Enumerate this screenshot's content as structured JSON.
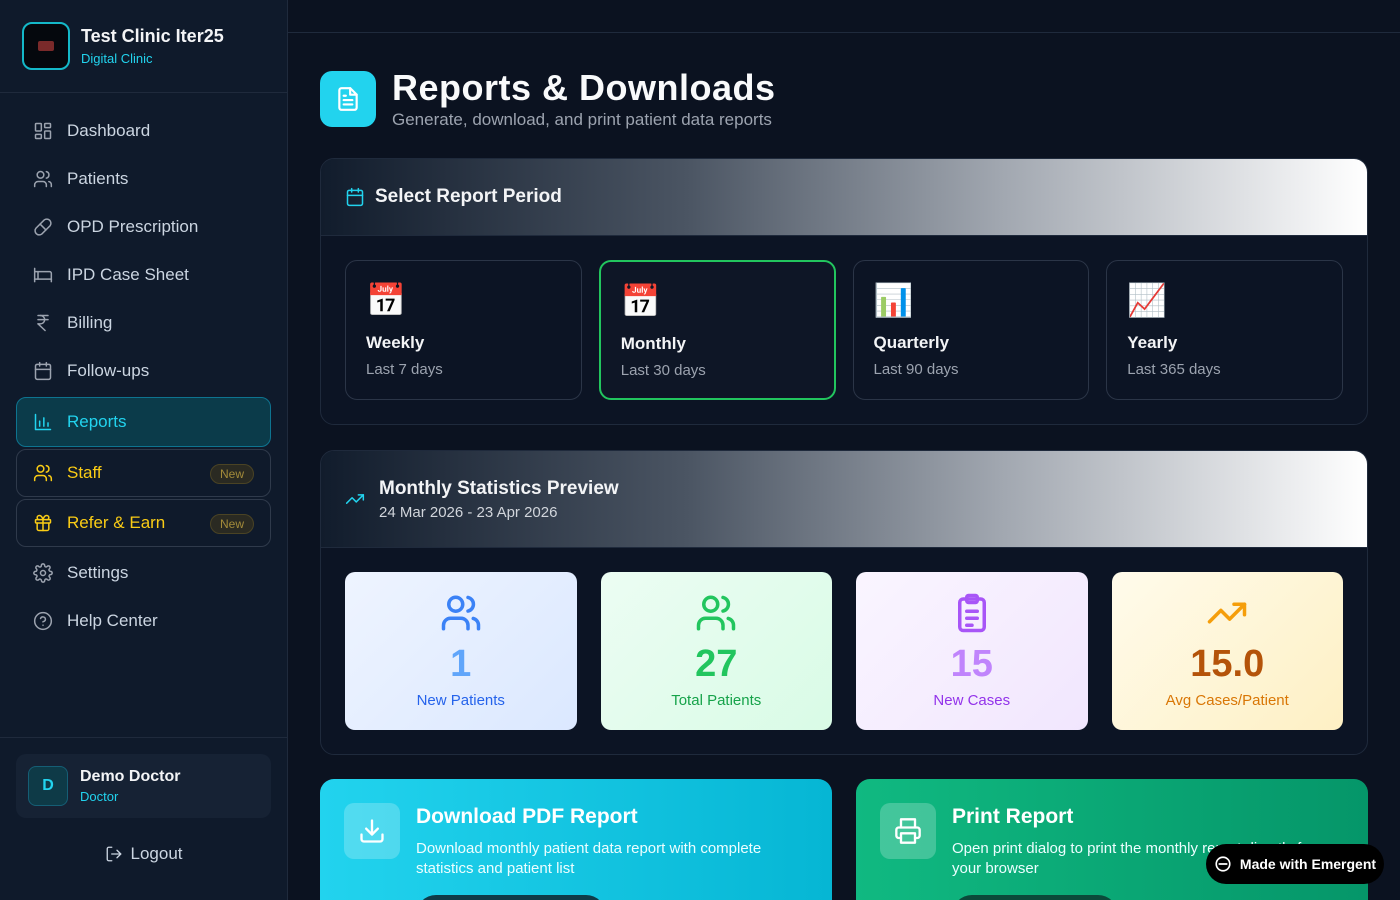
{
  "brand": {
    "title": "Test Clinic Iter25",
    "subtitle": "Digital Clinic"
  },
  "nav": {
    "items": [
      {
        "label": "Dashboard",
        "icon": "dashboard-icon"
      },
      {
        "label": "Patients",
        "icon": "users-icon"
      },
      {
        "label": "OPD Prescription",
        "icon": "pill-icon"
      },
      {
        "label": "IPD Case Sheet",
        "icon": "bed-icon"
      },
      {
        "label": "Billing",
        "icon": "rupee-icon"
      },
      {
        "label": "Follow-ups",
        "icon": "calendar-icon"
      },
      {
        "label": "Reports",
        "icon": "bar-chart-icon",
        "active": true
      },
      {
        "label": "Staff",
        "icon": "users-icon",
        "badge": "New"
      },
      {
        "label": "Refer & Earn",
        "icon": "gift-icon",
        "badge": "New"
      },
      {
        "label": "Settings",
        "icon": "gear-icon"
      },
      {
        "label": "Help Center",
        "icon": "help-circle-icon"
      }
    ]
  },
  "user": {
    "initial": "D",
    "name": "Demo Doctor",
    "role": "Doctor",
    "logout_label": "Logout"
  },
  "page": {
    "title": "Reports & Downloads",
    "subtitle": "Generate, download, and print patient data reports"
  },
  "period_panel": {
    "title": "Select Report Period",
    "options": [
      {
        "emoji": "📅",
        "label": "Weekly",
        "sub": "Last 7 days"
      },
      {
        "emoji": "📅",
        "label": "Monthly",
        "sub": "Last 30 days",
        "selected": true
      },
      {
        "emoji": "📊",
        "label": "Quarterly",
        "sub": "Last 90 days"
      },
      {
        "emoji": "📈",
        "label": "Yearly",
        "sub": "Last 365 days"
      }
    ]
  },
  "stats_panel": {
    "title": "Monthly Statistics Preview",
    "range": "24 Mar 2026 - 23 Apr 2026",
    "stats": [
      {
        "value": "1",
        "label": "New Patients"
      },
      {
        "value": "27",
        "label": "Total Patients"
      },
      {
        "value": "15",
        "label": "New Cases"
      },
      {
        "value": "15.0",
        "label": "Avg Cases/Patient"
      }
    ]
  },
  "actions": {
    "download": {
      "title": "Download PDF Report",
      "desc": "Download monthly patient data report with complete statistics and patient list"
    },
    "print": {
      "title": "Print Report",
      "desc": "Open print dialog to print the monthly report directly from your browser"
    }
  },
  "made_with": "Made with Emergent",
  "colors": {
    "accent": "#22d3ee",
    "selected_border": "#22c55e",
    "promo": "#facc15"
  }
}
